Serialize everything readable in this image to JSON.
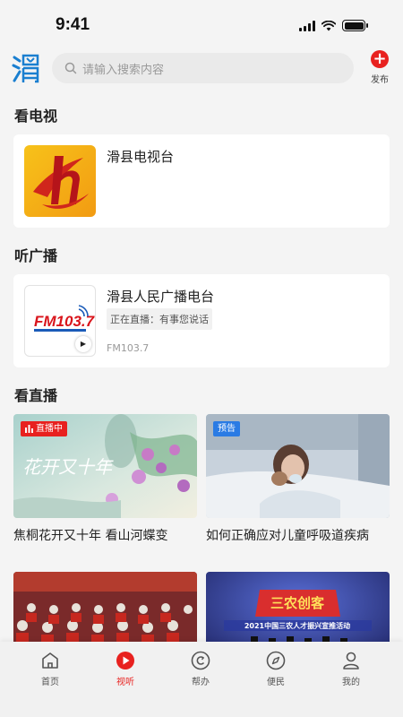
{
  "status_bar": {
    "time": "9:41"
  },
  "header": {
    "search_placeholder": "请输入搜索内容",
    "publish_label": "发布"
  },
  "sections": {
    "tv": "看电视",
    "radio": "听广播",
    "live": "看直播"
  },
  "tv_station": {
    "name": "滑县电视台"
  },
  "radio_station": {
    "name": "滑县人民广播电台",
    "live_text": "正在直播：有事您说话",
    "frequency": "FM103.7",
    "logo_text": "FM103.7"
  },
  "videos": [
    {
      "title": "焦桐花开又十年 看山河蝶变",
      "badge": "直播中",
      "thumb_text": "花开又十年"
    },
    {
      "title": "如何正确应对儿童呼吸道疾病",
      "badge": "预告"
    },
    {
      "title": ""
    },
    {
      "title": "",
      "thumb_text": "2021中国三农人才振兴宣推活动"
    }
  ],
  "tabbar": [
    {
      "label": "首页",
      "icon": "home-icon"
    },
    {
      "label": "视听",
      "icon": "play-icon"
    },
    {
      "label": "帮办",
      "icon": "help-icon"
    },
    {
      "label": "便民",
      "icon": "compass-icon"
    },
    {
      "label": "我的",
      "icon": "user-icon"
    }
  ],
  "colors": {
    "accent": "#e8211f",
    "live_badge": "#e8211f",
    "preview_badge": "#2a7be4",
    "logo_blue": "#1a7fd0"
  }
}
